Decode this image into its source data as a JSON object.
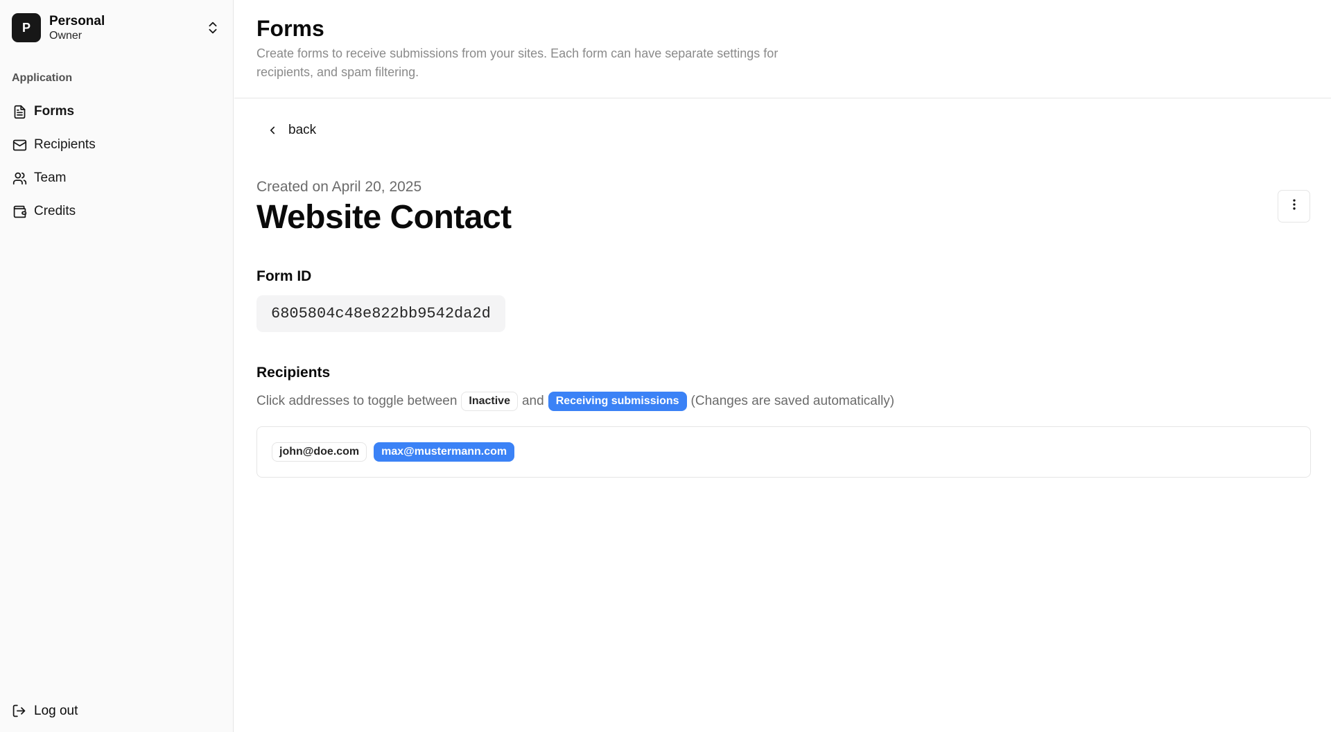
{
  "account": {
    "initial": "P",
    "name": "Personal",
    "role": "Owner"
  },
  "sidebar": {
    "section_label": "Application",
    "items": [
      {
        "label": "Forms",
        "icon": "file-text-icon",
        "active": true
      },
      {
        "label": "Recipients",
        "icon": "mail-icon",
        "active": false
      },
      {
        "label": "Team",
        "icon": "users-icon",
        "active": false
      },
      {
        "label": "Credits",
        "icon": "wallet-icon",
        "active": false
      }
    ],
    "logout_label": "Log out"
  },
  "header": {
    "title": "Forms",
    "description": "Create forms to receive submissions from your sites. Each form can have separate settings for recipients, and spam filtering."
  },
  "detail": {
    "back_label": "back",
    "created": "Created on April 20, 2025",
    "title": "Website Contact",
    "form_id_label": "Form ID",
    "form_id": "6805804c48e822bb9542da2d",
    "recipients_label": "Recipients",
    "recipients_hint_before": "Click addresses to toggle between",
    "inactive_label": "Inactive",
    "hint_and": "and",
    "active_label": "Receiving submissions",
    "recipients_hint_after": "(Changes are saved automatically)",
    "recipients": [
      {
        "email": "john@doe.com",
        "active": false
      },
      {
        "email": "max@mustermann.com",
        "active": true
      }
    ]
  },
  "colors": {
    "accent": "#3b82f6",
    "sidebar_bg": "#fafafa",
    "avatar_bg": "#171717"
  }
}
